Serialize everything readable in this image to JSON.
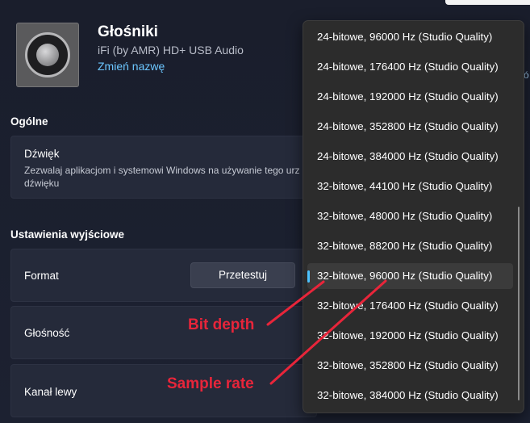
{
  "device": {
    "name": "Głośniki",
    "model": "iFi (by AMR) HD+ USB Audio",
    "rename_link": "Zmień nazwę"
  },
  "sections": {
    "general": "Ogólne",
    "output": "Ustawienia wyjściowe"
  },
  "sound_card": {
    "title": "Dźwięk",
    "desc_line1": "Zezwalaj aplikacjom i systemowi Windows na używanie tego urz",
    "desc_line2": "dźwięku"
  },
  "rows": {
    "format": "Format",
    "test_button": "Przetestuj",
    "volume": "Głośność",
    "left_channel": "Kanał lewy"
  },
  "right_peek": "ó",
  "annotations": {
    "bit_depth": "Bit depth",
    "sample_rate": "Sample rate"
  },
  "format_options": [
    "24-bitowe, 96000 Hz (Studio Quality)",
    "24-bitowe, 176400 Hz (Studio Quality)",
    "24-bitowe, 192000 Hz (Studio Quality)",
    "24-bitowe, 352800 Hz (Studio Quality)",
    "24-bitowe, 384000 Hz (Studio Quality)",
    "32-bitowe, 44100 Hz (Studio Quality)",
    "32-bitowe, 48000 Hz (Studio Quality)",
    "32-bitowe, 88200 Hz (Studio Quality)",
    "32-bitowe, 96000 Hz (Studio Quality)",
    "32-bitowe, 176400 Hz (Studio Quality)",
    "32-bitowe, 192000 Hz (Studio Quality)",
    "32-bitowe, 352800 Hz (Studio Quality)",
    "32-bitowe, 384000 Hz (Studio Quality)"
  ],
  "selected_index": 8,
  "colors": {
    "accent": "#4cc2ff",
    "link": "#6cc6ff",
    "annotation": "#e8253a",
    "background": "#1b1f2e",
    "card": "#252a3a",
    "dropdown": "#2c2c2c"
  }
}
